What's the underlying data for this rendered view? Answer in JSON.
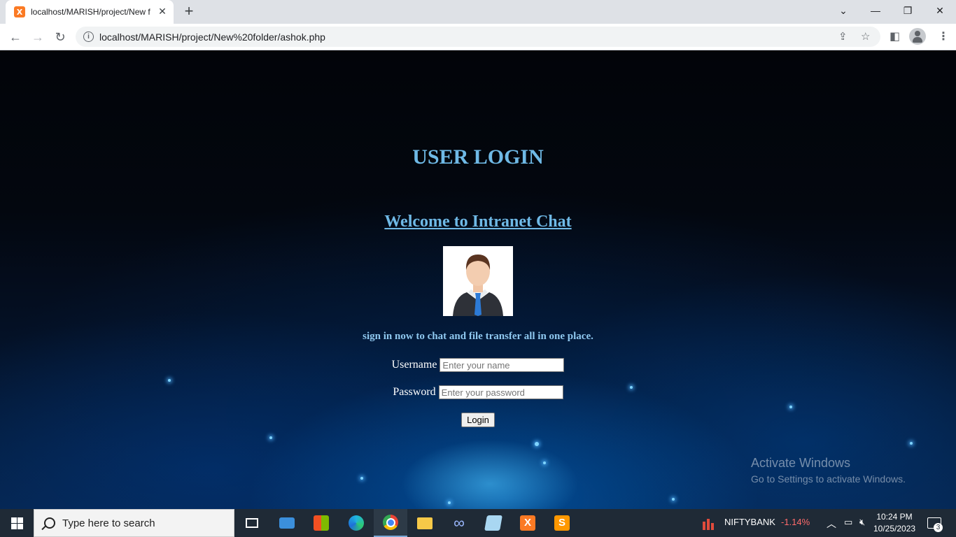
{
  "browser": {
    "tab_title": "localhost/MARISH/project/New f",
    "tab_favicon_letter": "X",
    "new_tab_icon": "+",
    "url": "localhost/MARISH/project/New%20folder/ashok.php"
  },
  "page": {
    "title": "USER LOGIN",
    "welcome": "Welcome to Intranet Chat",
    "tagline": "sign in now to chat and file transfer all in one place.",
    "username_label": "Username",
    "username_placeholder": "Enter your name",
    "password_label": "Password",
    "password_placeholder": "Enter your password",
    "login_button": "Login"
  },
  "watermark": {
    "title": "Activate Windows",
    "subtitle": "Go to Settings to activate Windows."
  },
  "taskbar": {
    "search_placeholder": "Type here to search",
    "apps": [
      "task-view",
      "mail",
      "microsoft-store",
      "edge",
      "chrome",
      "file-explorer",
      "app-infinity",
      "notepad",
      "xampp",
      "sublime-text"
    ],
    "stock_name": "NIFTYBANK",
    "stock_change": "-1.14%",
    "time": "10:24 PM",
    "date": "10/25/2023",
    "notification_count": "3"
  },
  "colors": {
    "heading": "#6fb9e6",
    "stock_negative": "#ff6b6b",
    "taskbar": "#1f2a36"
  }
}
